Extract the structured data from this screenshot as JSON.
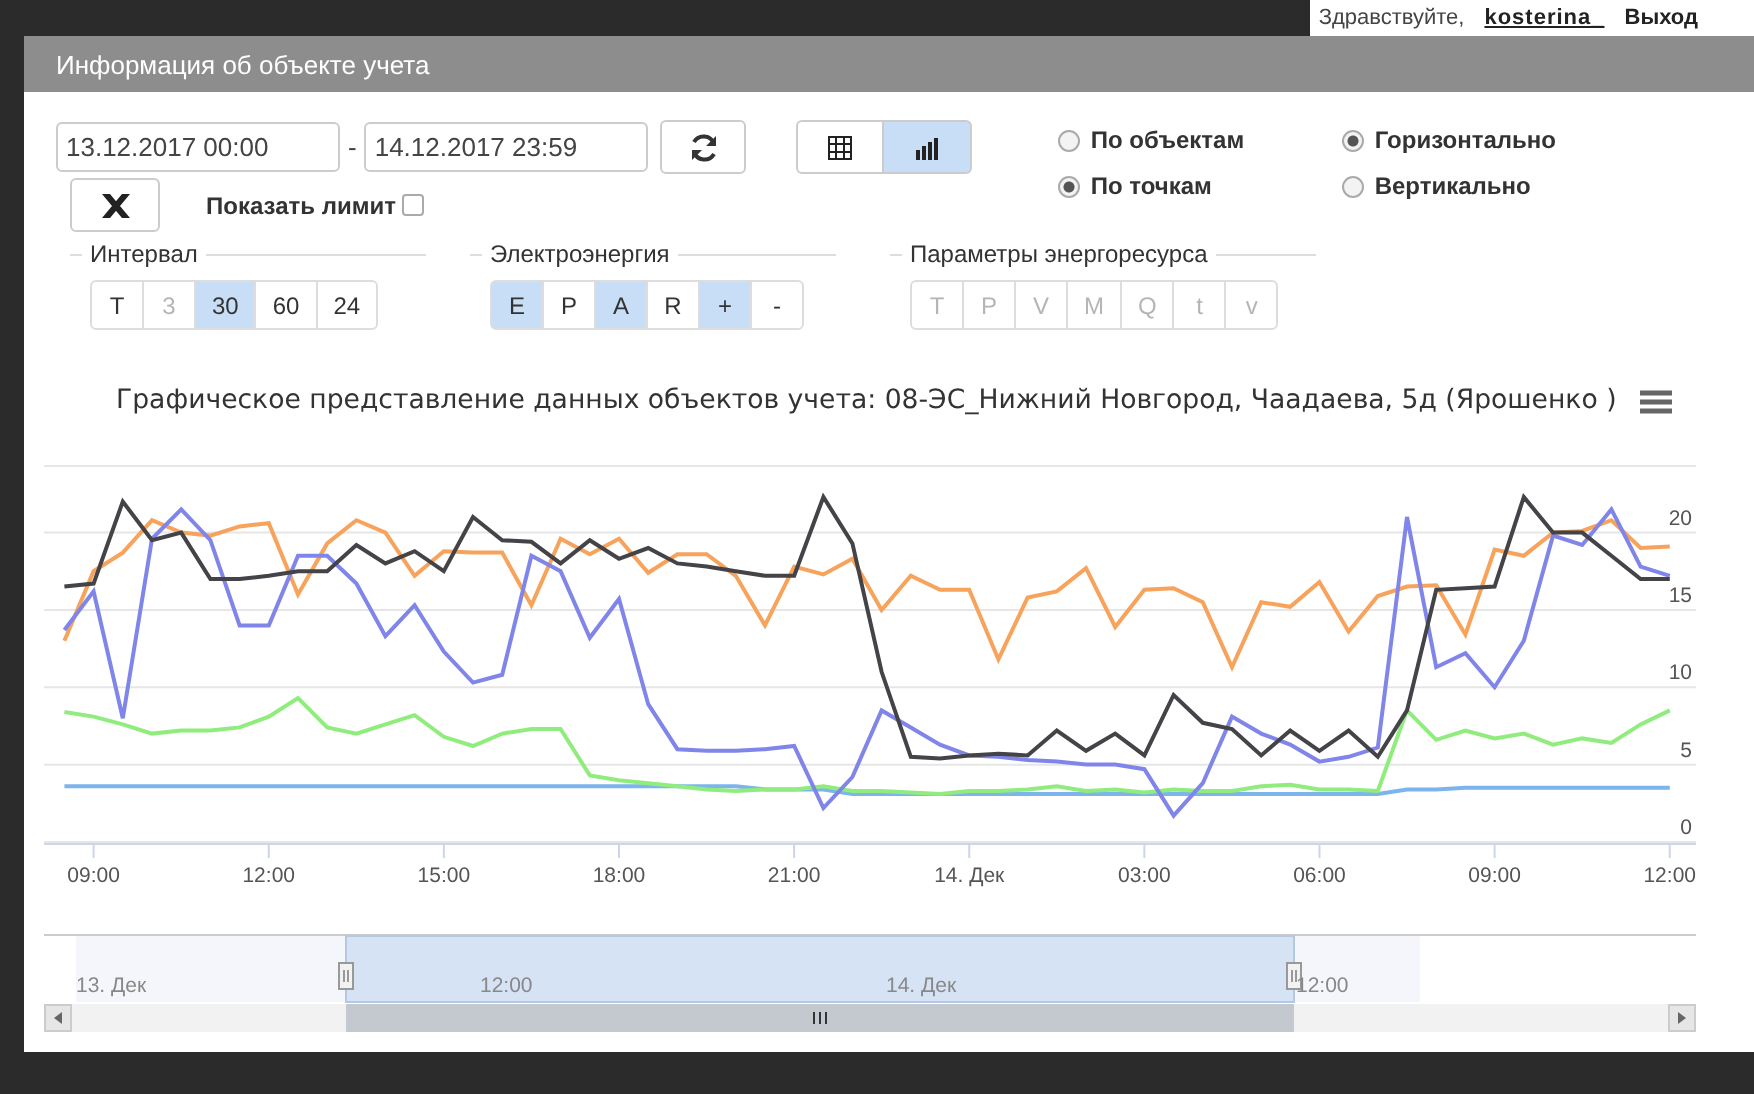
{
  "header": {
    "greeting": "Здравствуйте,",
    "user": "kosterina_",
    "logout": "Выход"
  },
  "dialog": {
    "title": "Информация об объекте учета",
    "date_from": {
      "value": "13.12.2017 00:00"
    },
    "date_separator": "-",
    "date_to": {
      "value": "14.12.2017 23:59"
    },
    "view_toggle": [
      {
        "kind": "table",
        "selected": false
      },
      {
        "kind": "chart",
        "selected": true
      }
    ],
    "show_limit": {
      "label": "Показать лимит",
      "checked": false
    },
    "radio_groups": [
      [
        {
          "label": "По объектам",
          "selected": false
        },
        {
          "label": "По точкам",
          "selected": true
        }
      ],
      [
        {
          "label": "Горизонтально",
          "selected": true
        },
        {
          "label": "Вертикально",
          "selected": false
        }
      ]
    ],
    "button_groups": [
      {
        "title": "Интервал",
        "buttons": [
          {
            "label": "T",
            "selected": false,
            "disabled": false
          },
          {
            "label": "3",
            "selected": false,
            "disabled": true
          },
          {
            "label": "30",
            "selected": true,
            "disabled": false
          },
          {
            "label": "60",
            "selected": false,
            "disabled": false
          },
          {
            "label": "24",
            "selected": false,
            "disabled": false
          }
        ]
      },
      {
        "title": "Электроэнергия",
        "buttons": [
          {
            "label": "E",
            "selected": true,
            "disabled": false
          },
          {
            "label": "P",
            "selected": false,
            "disabled": false
          },
          {
            "label": "A",
            "selected": true,
            "disabled": false
          },
          {
            "label": "R",
            "selected": false,
            "disabled": false
          },
          {
            "label": "+",
            "selected": true,
            "disabled": false
          },
          {
            "label": "-",
            "selected": false,
            "disabled": false
          }
        ]
      },
      {
        "title": "Параметры энергоресурса",
        "buttons": [
          {
            "label": "T",
            "selected": false,
            "disabled": true
          },
          {
            "label": "P",
            "selected": false,
            "disabled": true
          },
          {
            "label": "V",
            "selected": false,
            "disabled": true
          },
          {
            "label": "M",
            "selected": false,
            "disabled": true
          },
          {
            "label": "Q",
            "selected": false,
            "disabled": true
          },
          {
            "label": "t",
            "selected": false,
            "disabled": true
          },
          {
            "label": "v",
            "selected": false,
            "disabled": true
          }
        ]
      }
    ],
    "chart": {
      "title": "Графическое представление данных объектов учета: 08-ЭС_Нижний Новгород, Чаадаева, 5д (Ярошенко )",
      "chart_data": {
        "type": "line",
        "categories": [
          null,
          "09:00",
          null,
          null,
          null,
          null,
          null,
          "12:00",
          null,
          null,
          null,
          null,
          null,
          "15:00",
          null,
          null,
          null,
          null,
          null,
          "18:00",
          null,
          null,
          null,
          null,
          null,
          "21:00",
          null,
          null,
          null,
          null,
          null,
          "14. Дек",
          null,
          null,
          null,
          null,
          null,
          "03:00",
          null,
          null,
          null,
          null,
          null,
          "06:00",
          null,
          null,
          null,
          null,
          null,
          "09:00",
          null,
          null,
          null,
          null,
          null,
          "12:00"
        ],
        "ylim": [
          0,
          24.3
        ],
        "grid": true,
        "yticks": [
          0,
          5,
          10,
          15,
          20
        ],
        "series": [
          {
            "color": "#7cb5ec",
            "values": [
              3.6,
              3.6,
              3.6,
              3.6,
              3.6,
              3.6,
              3.6,
              3.6,
              3.6,
              3.6,
              3.6,
              3.6,
              3.6,
              3.6,
              3.6,
              3.6,
              3.6,
              3.6,
              3.6,
              3.6,
              3.6,
              3.6,
              3.6,
              3.6,
              3.4,
              3.4,
              3.4,
              3.1,
              3.1,
              3.1,
              3.1,
              3.1,
              3.1,
              3.1,
              3.1,
              3.1,
              3.1,
              3.1,
              3.1,
              3.1,
              3.1,
              3.1,
              3.1,
              3.1,
              3.1,
              3.1,
              3.4,
              3.4,
              3.5,
              3.5,
              3.5,
              3.5,
              3.5,
              3.5,
              3.5,
              3.5
            ]
          },
          {
            "color": "#90ed7d",
            "values": [
              8.4,
              8.1,
              7.6,
              7,
              7.2,
              7.2,
              7.4,
              8.1,
              9.3,
              7.4,
              7,
              7.6,
              8.2,
              6.8,
              6.2,
              7,
              7.3,
              7.3,
              4.3,
              4,
              3.8,
              3.6,
              3.4,
              3.3,
              3.4,
              3.4,
              3.6,
              3.3,
              3.3,
              3.2,
              3.1,
              3.3,
              3.3,
              3.4,
              3.6,
              3.3,
              3.4,
              3.2,
              3.4,
              3.3,
              3.3,
              3.6,
              3.7,
              3.4,
              3.4,
              3.3,
              8.5,
              6.6,
              7.2,
              6.7,
              7,
              6.3,
              6.7,
              6.4,
              7.6,
              8.5
            ]
          },
          {
            "color": "#f7a35c",
            "values": [
              13,
              17.5,
              18.7,
              20.8,
              20,
              19.8,
              20.4,
              20.6,
              16,
              19.3,
              20.8,
              20,
              17.2,
              18.8,
              18.7,
              18.7,
              15.3,
              19.6,
              18.6,
              19.6,
              17.4,
              18.6,
              18.6,
              17.2,
              14,
              17.8,
              17.3,
              18.3,
              15,
              17.2,
              16.3,
              16.3,
              11.8,
              15.8,
              16.2,
              17.7,
              13.9,
              16.3,
              16.4,
              15.5,
              11.3,
              15.5,
              15.2,
              16.8,
              13.6,
              15.9,
              16.5,
              16.6,
              13.4,
              18.9,
              18.5,
              20,
              20.1,
              20.8,
              19,
              19.1
            ]
          },
          {
            "color": "#8085e9",
            "values": [
              13.7,
              16.2,
              8,
              19.6,
              21.5,
              19.5,
              14,
              14,
              18.5,
              18.5,
              16.7,
              13.3,
              15.3,
              12.3,
              10.3,
              10.8,
              18.5,
              17.5,
              13.2,
              15.7,
              8.9,
              6,
              5.9,
              5.9,
              6,
              6.2,
              2.2,
              4.2,
              8.5,
              7.4,
              6.3,
              5.6,
              5.5,
              5.3,
              5.2,
              5,
              5,
              4.7,
              1.7,
              3.8,
              8.1,
              7,
              6.3,
              5.2,
              5.5,
              6.1,
              21,
              11.3,
              12.2,
              10,
              13,
              19.8,
              19.2,
              21.5,
              17.8,
              17.2
            ]
          },
          {
            "color": "#434348",
            "values": [
              16.5,
              16.7,
              22,
              19.5,
              20,
              17,
              17,
              17.2,
              17.5,
              17.5,
              19.2,
              18,
              18.8,
              17.5,
              21,
              19.5,
              19.4,
              18,
              19.5,
              18.3,
              19,
              18,
              17.8,
              17.5,
              17.2,
              17.2,
              22.3,
              19.3,
              11,
              5.5,
              5.4,
              5.6,
              5.7,
              5.6,
              7.2,
              5.9,
              7,
              5.6,
              9.5,
              7.7,
              7.3,
              5.6,
              7.2,
              5.9,
              7.2,
              5.5,
              8.5,
              16.3,
              16.4,
              16.5,
              22.3,
              20,
              20,
              18.5,
              17,
              17
            ]
          }
        ]
      }
    },
    "navigator": {
      "labels": [
        "13. Дек",
        "12:00",
        "14. Дек",
        "12:00"
      ]
    }
  }
}
